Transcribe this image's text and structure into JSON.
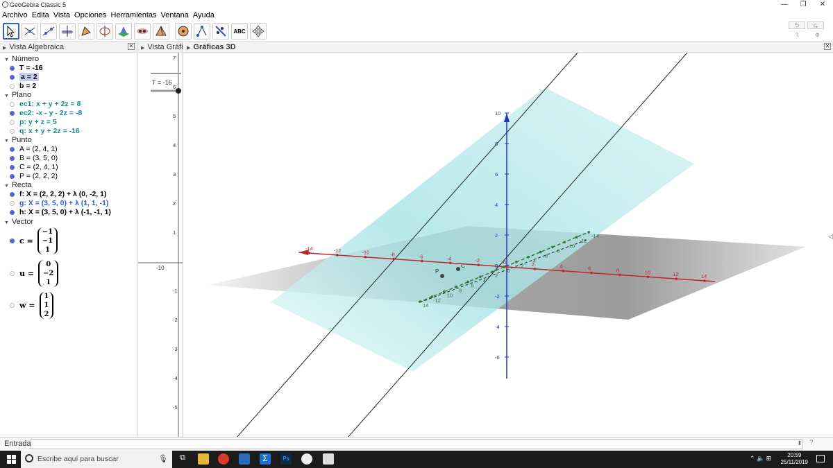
{
  "window": {
    "title": "GeoGebra Classic 5"
  },
  "menu": [
    "Archivo",
    "Edita",
    "Vista",
    "Opciones",
    "Herramientas",
    "Ventana",
    "Ayuda"
  ],
  "toolbar": {
    "abc_label": "ABC"
  },
  "algebra": {
    "header": "Vista Algebraica",
    "groups": {
      "numero": "Número",
      "plano": "Plano",
      "punto": "Punto",
      "recta": "Recta",
      "vector": "Vector"
    },
    "numero_items": [
      "T = -16",
      "a = 2",
      "b = 2"
    ],
    "plano_items": [
      "ec1: x + y + 2z = 8",
      "ec2: -x - y - 2z = -8",
      "p: y + z = 5",
      "q: x + y + 2z = -16"
    ],
    "punto_items": [
      "A = (2, 4, 1)",
      "B = (3, 5, 0)",
      "C = (2, 4, 1)",
      "P = (2, 2, 2)"
    ],
    "recta_items": [
      "f: X = (2, 2, 2) + λ (0, -2, 1)",
      "g: X = (3, 5, 0) + λ (1, 1, -1)",
      "h: X = (3, 5, 0) + λ (-1, -1, 1)"
    ],
    "vectors": [
      {
        "name": "c =",
        "values": [
          "−1",
          "−1",
          "1"
        ]
      },
      {
        "name": "u =",
        "values": [
          "0",
          "−2",
          "1"
        ]
      },
      {
        "name": "w =",
        "values": [
          "1",
          "1",
          "2"
        ]
      }
    ]
  },
  "graphics2d": {
    "header": "Vista Gráfic",
    "slider_label": "T = -16",
    "y_ticks": [
      "7",
      "6",
      "5",
      "4",
      "3",
      "2",
      "1",
      "-1",
      "-2",
      "-3",
      "-4",
      "-5"
    ],
    "x_tick": "-10"
  },
  "graphics3d": {
    "header": "Gráficas 3D",
    "x_ticks": [
      "-14",
      "-12",
      "-10",
      "-8",
      "-6",
      "-4",
      "-2",
      "0",
      "2",
      "4",
      "6",
      "8",
      "10",
      "12",
      "14"
    ],
    "y_ticks": [
      "14",
      "12",
      "10",
      "8",
      "6",
      "4",
      "2",
      "0",
      "-2",
      "-4",
      "-6",
      "-8",
      "-10",
      "-12",
      "-14"
    ],
    "z_ticks": [
      "10",
      "8",
      "6",
      "4",
      "2",
      "0",
      "-2",
      "-4",
      "-6"
    ],
    "point_labels": [
      "C",
      "P"
    ]
  },
  "input": {
    "label": "Entrada:",
    "value": ""
  },
  "taskbar": {
    "search_placeholder": "Escribe aquí para buscar",
    "time": "20:59",
    "date": "25/11/2019"
  },
  "colors": {
    "plane_cyan": "#a6e3e6",
    "plane_gray": "#8c8c8c",
    "x_axis": "#c0262a",
    "y_axis": "#2f7a3a",
    "z_axis": "#1f35b8",
    "selected_dot": "#5865d6",
    "teal_text": "#138d8d",
    "blue_text": "#2d5bd6"
  }
}
